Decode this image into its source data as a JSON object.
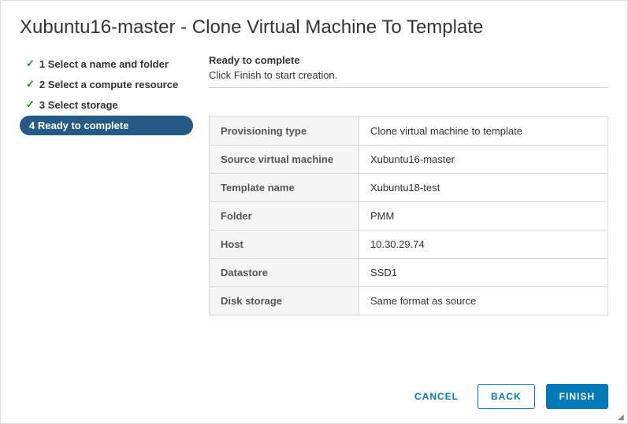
{
  "title": "Xubuntu16-master - Clone Virtual Machine To Template",
  "steps": [
    {
      "label": "1 Select a name and folder"
    },
    {
      "label": "2 Select a compute resource"
    },
    {
      "label": "3 Select storage"
    },
    {
      "label": "4 Ready to complete"
    }
  ],
  "section": {
    "title": "Ready to complete",
    "desc": "Click Finish to start creation."
  },
  "summary": [
    {
      "label": "Provisioning type",
      "value": "Clone virtual machine to template"
    },
    {
      "label": "Source virtual machine",
      "value": "Xubuntu16-master"
    },
    {
      "label": "Template name",
      "value": "Xubuntu18-test"
    },
    {
      "label": "Folder",
      "value": "PMM"
    },
    {
      "label": "Host",
      "value": "10.30.29.74"
    },
    {
      "label": "Datastore",
      "value": "SSD1"
    },
    {
      "label": "Disk storage",
      "value": "Same format as source"
    }
  ],
  "buttons": {
    "cancel": "CANCEL",
    "back": "BACK",
    "finish": "FINISH"
  }
}
